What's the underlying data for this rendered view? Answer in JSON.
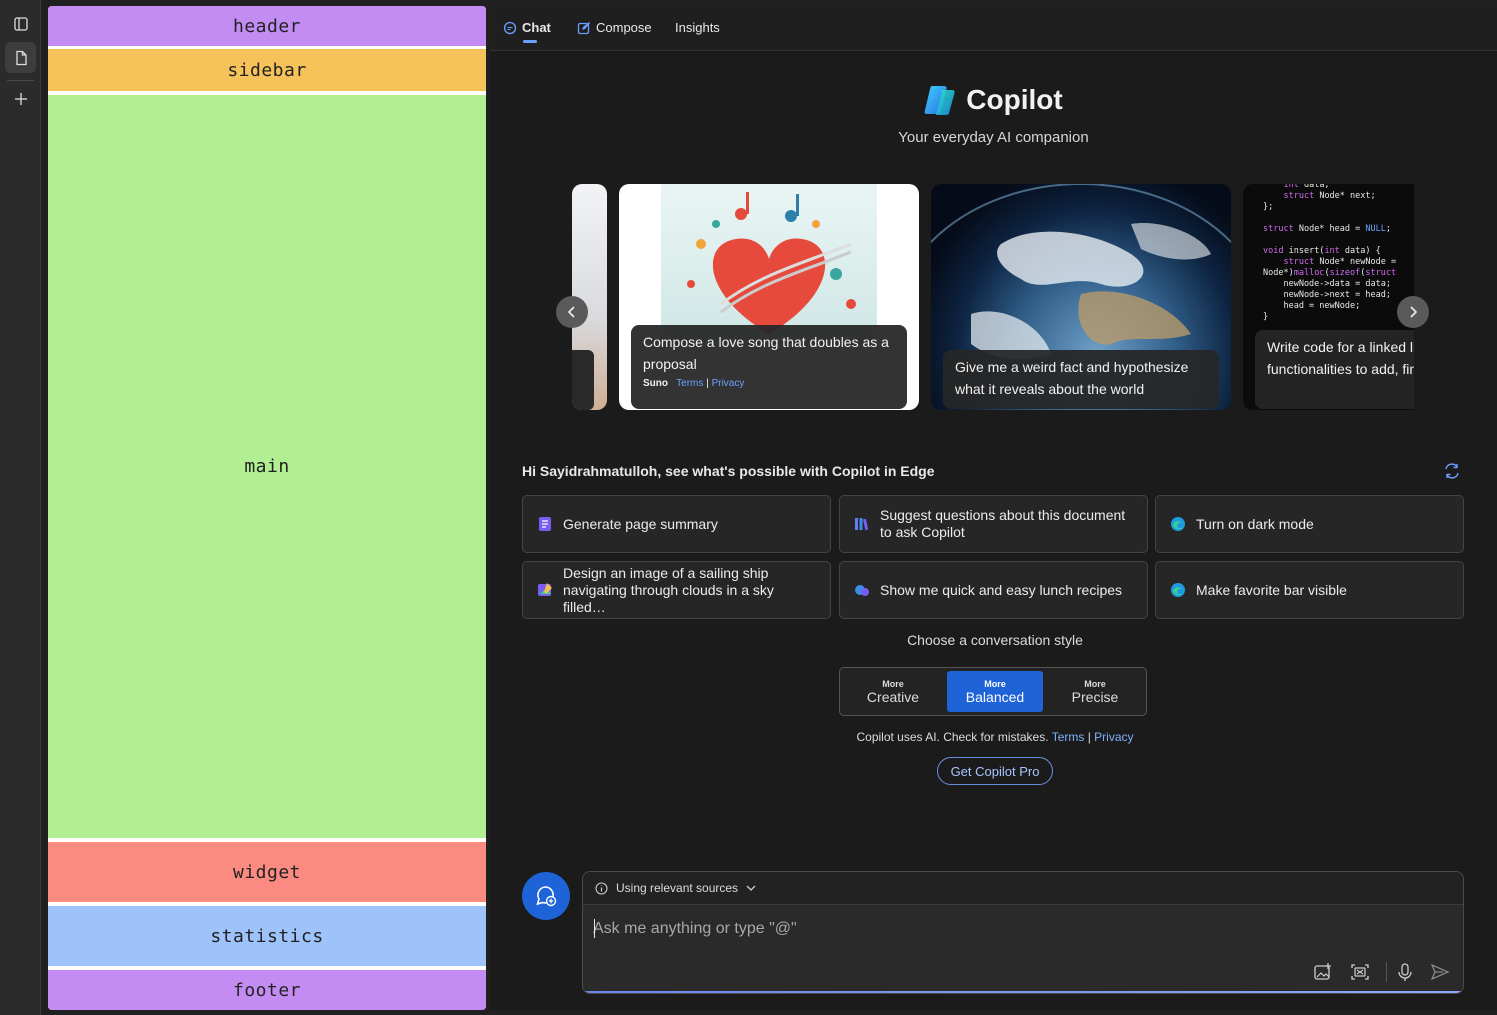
{
  "wireframe": {
    "blocks": [
      "header",
      "sidebar",
      "main",
      "widget",
      "statistics",
      "footer"
    ]
  },
  "vertical_toolbar": {
    "icons": [
      "tab-actions-icon",
      "page-icon",
      "add-icon"
    ]
  },
  "tabs": [
    {
      "label": "Chat",
      "icon": "chat-icon",
      "active": true
    },
    {
      "label": "Compose",
      "icon": "compose-icon",
      "active": false
    },
    {
      "label": "Insights",
      "icon": "",
      "active": false
    }
  ],
  "hero": {
    "title": "Copilot",
    "subtitle": "Your everyday AI companion"
  },
  "carousel": {
    "cards": [
      {
        "caption": "Compose a love song that doubles as a proposal",
        "provider": "Suno",
        "terms": "Terms",
        "privacy": "Privacy"
      },
      {
        "caption": "Give me a weird fact and hypothesize what it reveals about the world"
      },
      {
        "caption": "Write code for a linked list with functionalities to add, find nodes"
      }
    ],
    "code_lines": [
      "    int data;",
      "    struct Node* next;",
      "};",
      "",
      "struct Node* head = NULL;",
      "",
      "void insert(int data) {",
      "    struct Node* newNode =",
      "Node*)malloc(sizeof(struct",
      "    newNode->data = data;",
      "    newNode->next = head;",
      "    head = newNode;",
      "}"
    ]
  },
  "greeting": "Hi Sayidrahmatulloh, see what's possible with Copilot in Edge",
  "suggestions": [
    {
      "label": "Generate page summary",
      "icon": "summary-icon"
    },
    {
      "label": "Suggest questions about this document to ask Copilot",
      "icon": "books-icon"
    },
    {
      "label": "Turn on dark mode",
      "icon": "edge-icon"
    },
    {
      "label": "Design an image of a sailing ship navigating through clouds in a sky filled…",
      "icon": "image-design-icon"
    },
    {
      "label": "Show me quick and easy lunch recipes",
      "icon": "chat-bubbles-icon"
    },
    {
      "label": "Make favorite bar visible",
      "icon": "edge-icon"
    }
  ],
  "conversation_style": {
    "label": "Choose a conversation style",
    "options": [
      {
        "more": "More",
        "name": "Creative",
        "selected": false
      },
      {
        "more": "More",
        "name": "Balanced",
        "selected": true
      },
      {
        "more": "More",
        "name": "Precise",
        "selected": false
      }
    ]
  },
  "disclaimer": {
    "text": "Copilot uses AI. Check for mistakes.",
    "terms": "Terms",
    "sep": "|",
    "privacy": "Privacy"
  },
  "pro_button": "Get Copilot Pro",
  "composer": {
    "sources_label": "Using relevant sources",
    "placeholder": "Ask me anything or type \"@\"",
    "tools": [
      "add-image-icon",
      "screenshot-icon",
      "microphone-icon",
      "send-icon"
    ]
  },
  "colors": {
    "accent": "#1f63d8",
    "link": "#6aa1ff",
    "panel_bg": "#1b1b1b"
  }
}
